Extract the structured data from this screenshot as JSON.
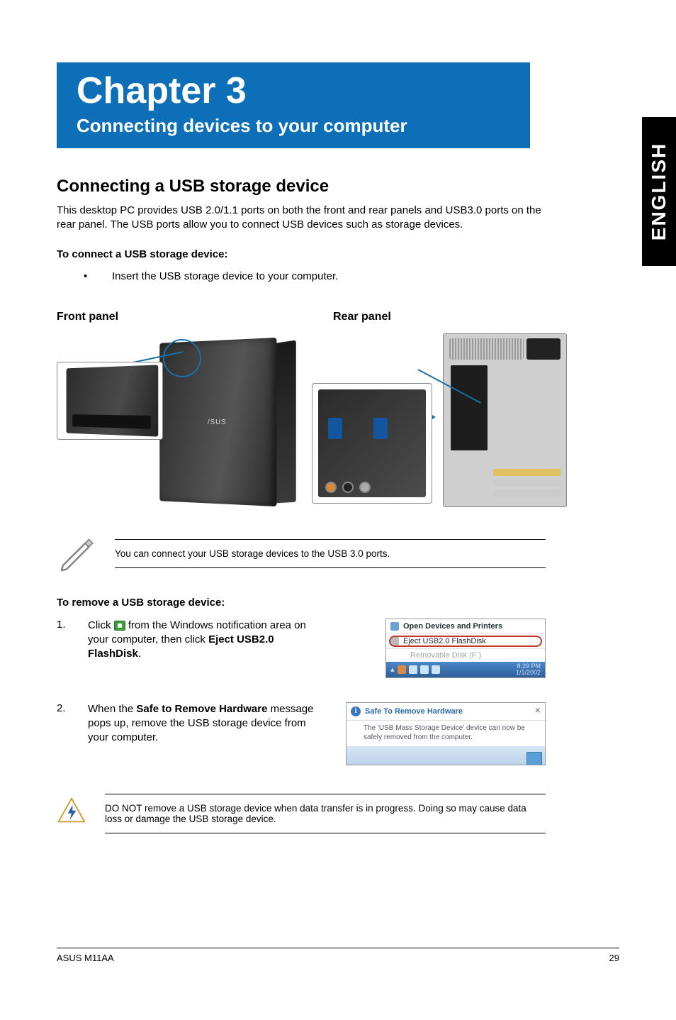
{
  "side_tab": "ENGLISH",
  "chapter": {
    "title": "Chapter 3",
    "subtitle": "Connecting devices to your computer"
  },
  "section": {
    "heading": "Connecting a USB storage device",
    "intro": "This desktop PC provides USB 2.0/1.1 ports on both the front and rear panels and USB3.0 ports on the rear panel. The USB ports allow you to connect USB devices such as storage devices.",
    "connect_title": "To connect a USB storage device:",
    "connect_bullet": "Insert the USB storage device to your computer.",
    "front_label": "Front panel",
    "rear_label": "Rear panel",
    "note_usb3": "You can connect your USB storage devices to the USB 3.0 ports.",
    "remove_title": "To remove a USB storage device:",
    "steps": [
      {
        "num": "1.",
        "pre": "Click ",
        "post": " from the Windows notification area on your computer, then click ",
        "bold": "Eject USB2.0 FlashDisk",
        "tail": "."
      },
      {
        "num": "2.",
        "pre": "When the ",
        "bold": "Safe to Remove Hardware",
        "post": " message pops up, remove the USB storage device from your computer."
      }
    ],
    "warning": "DO NOT remove a USB storage device when data transfer is in progress. Doing so may cause data loss or damage the USB storage device."
  },
  "screenshot1": {
    "row1": "Open Devices and Printers",
    "row2": "Eject USB2.0 FlashDisk",
    "sub": "Removable Disk (F:)",
    "time": "8:29 PM",
    "date": "1/1/2002"
  },
  "screenshot2": {
    "title": "Safe To Remove Hardware",
    "body": "The 'USB Mass Storage Device' device can now be safely removed from the computer.",
    "close": "✕"
  },
  "footer": {
    "left": "ASUS M11AA",
    "right": "29"
  }
}
